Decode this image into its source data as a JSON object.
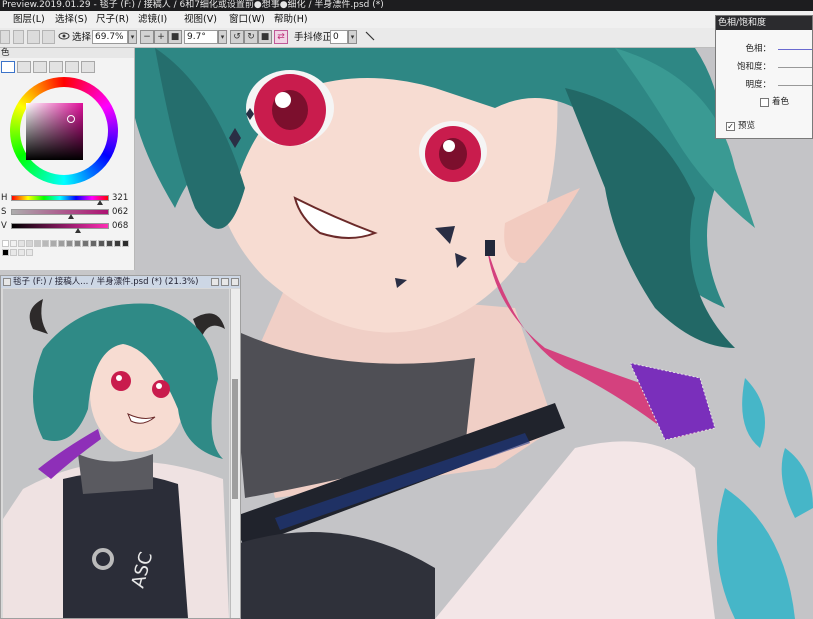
{
  "window": {
    "title": "Preview.2019.01.29 - 毯子 (F:) / 接稿人 / 6和7细化或设置前●想事●细化 / 半身漂件.psd (*)"
  },
  "menu": {
    "items": [
      "图层(L)",
      "选择(S)",
      "尺子(R)",
      "滤镜(I)",
      "视图(V)",
      "窗口(W)",
      "帮助(H)"
    ]
  },
  "toolbar": {
    "select_label": "选择",
    "zoom_value": "69.7%",
    "angle_value": "9.7°",
    "stabilizer_label": "手抖修正",
    "stabilizer_value": "0"
  },
  "color_panel": {
    "title": "色",
    "hue_label": "H",
    "hue_value": "321",
    "sat_label": "S",
    "sat_value": "062",
    "val_label": "V",
    "val_value": "068",
    "hue": 0.89,
    "saturation": 0.62,
    "value": 0.68,
    "current_color": "#ad4384"
  },
  "navigator": {
    "title": "毯子 (F:) / 接稿人... / 半身漂件.psd (*) (21.3%)"
  },
  "hue_dialog": {
    "title": "色相/饱和度",
    "hue_label": "色相：",
    "saturation_label": "饱和度：",
    "lightness_label": "明度：",
    "colorize_label": "着色",
    "preview_label": "预览",
    "preview_checked": "✓"
  },
  "colors": {
    "hair": "#2f8a86",
    "skin": "#f6d9cf",
    "eye": "#d8345e",
    "ribbon": "#7a2fbb",
    "flame": "#47b7c9"
  }
}
